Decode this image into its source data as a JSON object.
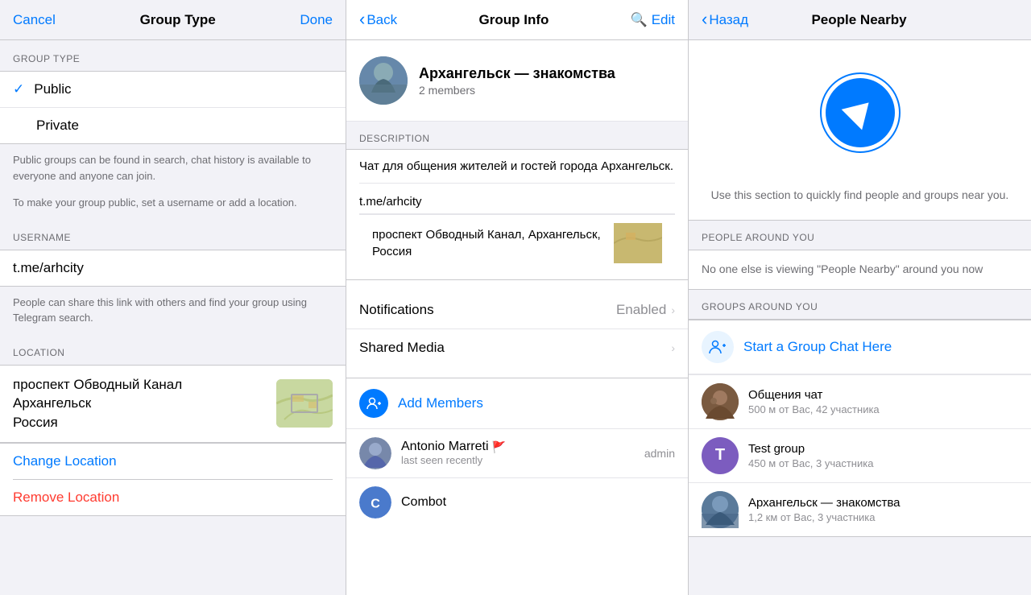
{
  "panel1": {
    "nav": {
      "cancel": "Cancel",
      "title": "Group Type",
      "done": "Done"
    },
    "section_group_type": "GROUP TYPE",
    "options": [
      {
        "label": "Public",
        "selected": true
      },
      {
        "label": "Private",
        "selected": false
      }
    ],
    "info_text1": "Public groups can be found in search, chat history is available to everyone and anyone can join.",
    "info_text2": "To make your group public, set a username or add a location.",
    "section_username": "USERNAME",
    "username_value": "t.me/arhcity",
    "username_info": "People can share this link with others and find your group using Telegram search.",
    "section_location": "LOCATION",
    "location_line1": "проспект Обводный Канал",
    "location_line2": "Архангельск",
    "location_line3": "Россия",
    "change_location": "Change Location",
    "remove_location": "Remove Location"
  },
  "panel2": {
    "nav": {
      "back": "Back",
      "title": "Group Info",
      "edit": "Edit"
    },
    "group": {
      "name": "Архангельск — знакомства",
      "members": "2 members"
    },
    "section_description": "DESCRIPTION",
    "description_text": "Чат для общения жителей и гостей города Архангельск.",
    "link": "t.me/arhcity",
    "location": "проспект Обводный Канал, Архангельск, Россия",
    "notifications_label": "Notifications",
    "notifications_value": "Enabled",
    "shared_media_label": "Shared Media",
    "add_members_label": "Add Members",
    "members": [
      {
        "name": "Antonio Marreti",
        "status": "last seen recently",
        "role": "admin",
        "has_flag": true,
        "avatar_color": "#8899aa"
      },
      {
        "name": "Combot",
        "status": "",
        "role": "",
        "has_flag": false,
        "avatar_color": "#4a7acc",
        "avatar_letter": "C"
      }
    ]
  },
  "panel3": {
    "nav": {
      "back": "Назад",
      "title": "People Nearby"
    },
    "description": "Use this section to quickly find people and groups near you.",
    "section_people": "PEOPLE AROUND YOU",
    "people_empty": "No one else is viewing \"People Nearby\" around you now",
    "section_groups": "GROUPS AROUND YOU",
    "start_chat_label": "Start a Group Chat Here",
    "groups": [
      {
        "name": "Общения чат",
        "sub": "500 м от Вас, 42 участника",
        "avatar_color": "#8a6a50",
        "avatar_letter": ""
      },
      {
        "name": "Test group",
        "sub": "450 м от Вас, 3 участника",
        "avatar_color": "#7c5cbf",
        "avatar_letter": "T"
      },
      {
        "name": "Архангельск — знакомства",
        "sub": "1,2 км от Вас, 3 участника",
        "avatar_color": "#5a8aaa",
        "avatar_letter": ""
      }
    ]
  }
}
